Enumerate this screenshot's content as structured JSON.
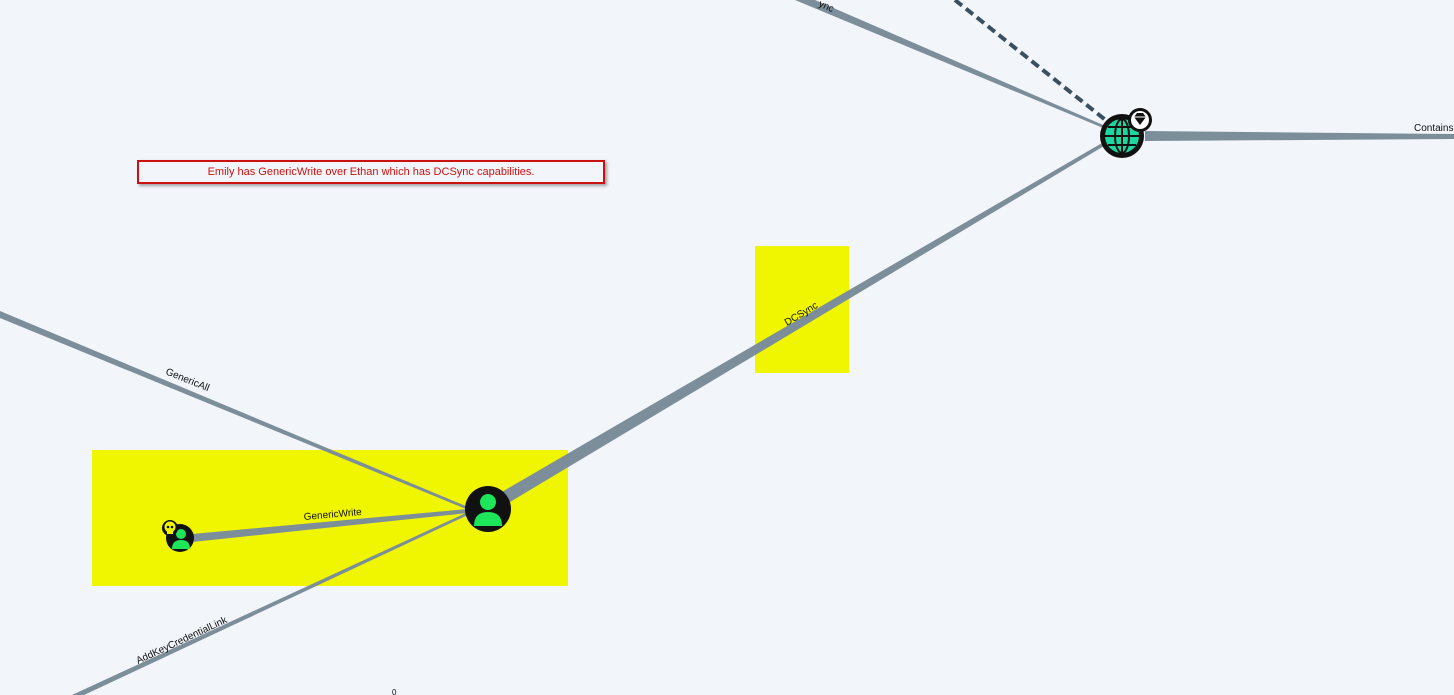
{
  "annotation": {
    "text": "Emily has GenericWrite over Ethan which has DCSync capabilities."
  },
  "edges": {
    "top_partial_label": "ync",
    "contains_label": "Contains",
    "dcsync_label": "DCSync",
    "genericall_label": "GenericAll",
    "genericwrite_label": "GenericWrite",
    "addkeycredentiallink_label": "AddKeyCredentialLink",
    "bottom_partial_label": "0"
  },
  "nodes": {
    "domain_icon": "globe-icon",
    "domain_badge_icon": "diamond-icon",
    "user_ethan_icon": "user-icon",
    "user_emily_icon": "user-icon",
    "user_emily_badge_icon": "skull-icon"
  },
  "colors": {
    "background": "#f2f5fa",
    "edge": "#7b8e9a",
    "highlight": "#f0f500",
    "node_dark": "#111111",
    "user_green": "#1ee65a",
    "domain_teal": "#1ed6a0",
    "annotation_red": "#cc1111"
  }
}
